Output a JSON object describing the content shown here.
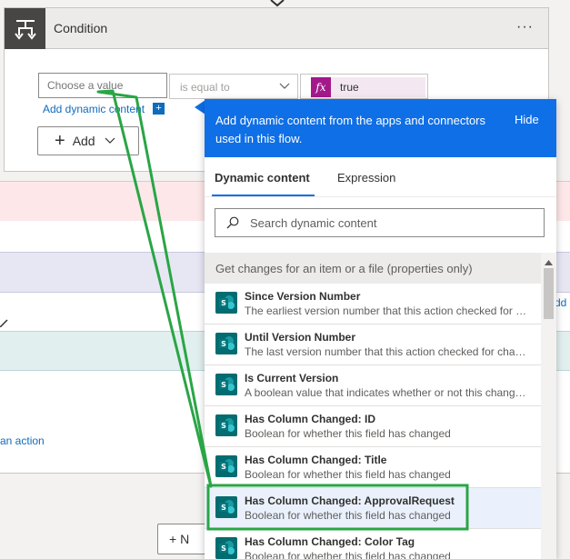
{
  "colors": {
    "panel_header": "#0f6fe6",
    "link": "#0f6cbd",
    "fx_token": "#a3198c",
    "sharepoint": "#036c70",
    "annotation": "#2aa546"
  },
  "condition": {
    "title": "Condition",
    "more": "···",
    "left_placeholder": "Choose a value",
    "operator": "is equal to",
    "right_value": "true",
    "fx": "fx",
    "add_dynamic": "Add dynamic content",
    "add_dynamic_plus": "+",
    "add_label": "Add"
  },
  "background": {
    "add_action": "an action",
    "add_right": "dd",
    "new_step": "+ N"
  },
  "panel": {
    "header_text": "Add dynamic content from the apps and connectors used in this flow.",
    "hide": "Hide",
    "tabs": [
      "Dynamic content",
      "Expression"
    ],
    "search_placeholder": "Search dynamic content",
    "group_title": "Get changes for an item or a file (properties only)",
    "items": [
      {
        "title": "Since Version Number",
        "desc": "The earliest version number that this action checked for changes"
      },
      {
        "title": "Until Version Number",
        "desc": "The last version number that this action checked for changes"
      },
      {
        "title": "Is Current Version",
        "desc": "A boolean value that indicates whether or not this change is the current version"
      },
      {
        "title": "Has Column Changed: ID",
        "desc": "Boolean for whether this field has changed"
      },
      {
        "title": "Has Column Changed: Title",
        "desc": "Boolean for whether this field has changed"
      },
      {
        "title": "Has Column Changed: ApprovalRequest",
        "desc": "Boolean for whether this field has changed"
      },
      {
        "title": "Has Column Changed: Color Tag",
        "desc": "Boolean for whether this field has changed"
      }
    ]
  }
}
